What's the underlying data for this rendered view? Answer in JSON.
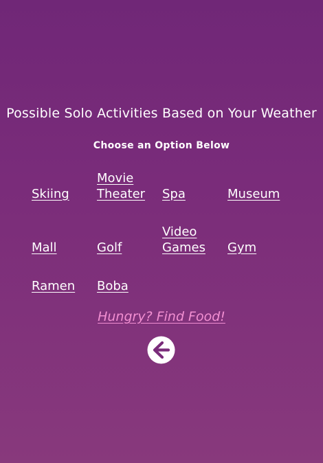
{
  "header": {
    "title": "Possible Solo Activities Based on Your Weather",
    "subtitle": "Choose an Option Below"
  },
  "activities": [
    {
      "label": "Skiing"
    },
    {
      "label": "Movie Theater"
    },
    {
      "label": "Spa"
    },
    {
      "label": "Museum"
    },
    {
      "label": "Mall"
    },
    {
      "label": "Golf"
    },
    {
      "label": "Video Games"
    },
    {
      "label": "Gym"
    },
    {
      "label": "Ramen"
    },
    {
      "label": "Boba"
    }
  ],
  "food_link": {
    "label": "Hungry? Find Food!"
  },
  "back_button": {
    "icon": "arrow-left-circle-icon"
  },
  "colors": {
    "background_top": "#702777",
    "background_bottom": "#88397c",
    "text": "#ffffff",
    "food_link": "#f28fd2"
  }
}
